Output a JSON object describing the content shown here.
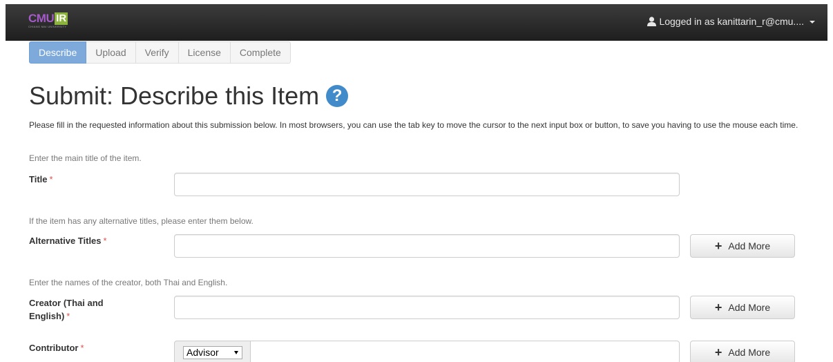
{
  "navbar": {
    "logo_main": "CMU",
    "logo_ir": "IR",
    "logo_sub": "CHIANG MAI UNIVERSITY",
    "user_label": "Logged in as kanittarin_r@cmu...."
  },
  "steps": [
    {
      "label": "Describe",
      "active": true
    },
    {
      "label": "Upload",
      "active": false
    },
    {
      "label": "Verify",
      "active": false
    },
    {
      "label": "License",
      "active": false
    },
    {
      "label": "Complete",
      "active": false
    }
  ],
  "page": {
    "title": "Submit: Describe this Item",
    "help_glyph": "?",
    "intro": "Please fill in the requested information about this submission below. In most browsers, you can use the tab key to move the cursor to the next input box or button, to save you having to use the mouse each time."
  },
  "fields": {
    "title": {
      "hint": "Enter the main title of the item.",
      "label": "Title",
      "required_mark": "*",
      "value": ""
    },
    "alt_titles": {
      "hint": "If the item has any alternative titles, please enter them below.",
      "label": "Alternative Titles",
      "required_mark": "*",
      "value": "",
      "add_label": "Add More"
    },
    "creator": {
      "hint": "Enter the names of the creator, both Thai and English.",
      "label_line1": "Creator (Thai and",
      "label_line2": "English)",
      "required_mark": "*",
      "value": "",
      "add_label": "Add More"
    },
    "contributor": {
      "label": "Contributor",
      "required_mark": "*",
      "role_selected": "Advisor",
      "value": "",
      "add_label": "Add More"
    }
  },
  "colors": {
    "navbar": "#2a2a2a",
    "active_step": "#7eaadb",
    "help_icon": "#428bca",
    "required": "#d9534f",
    "logo_cmu": "#a45ac8",
    "logo_ir": "#8cb43c"
  },
  "icons": {
    "user": "user-icon",
    "help": "question-circle-icon",
    "add": "plus-icon",
    "dropdown": "caret-down-icon"
  }
}
